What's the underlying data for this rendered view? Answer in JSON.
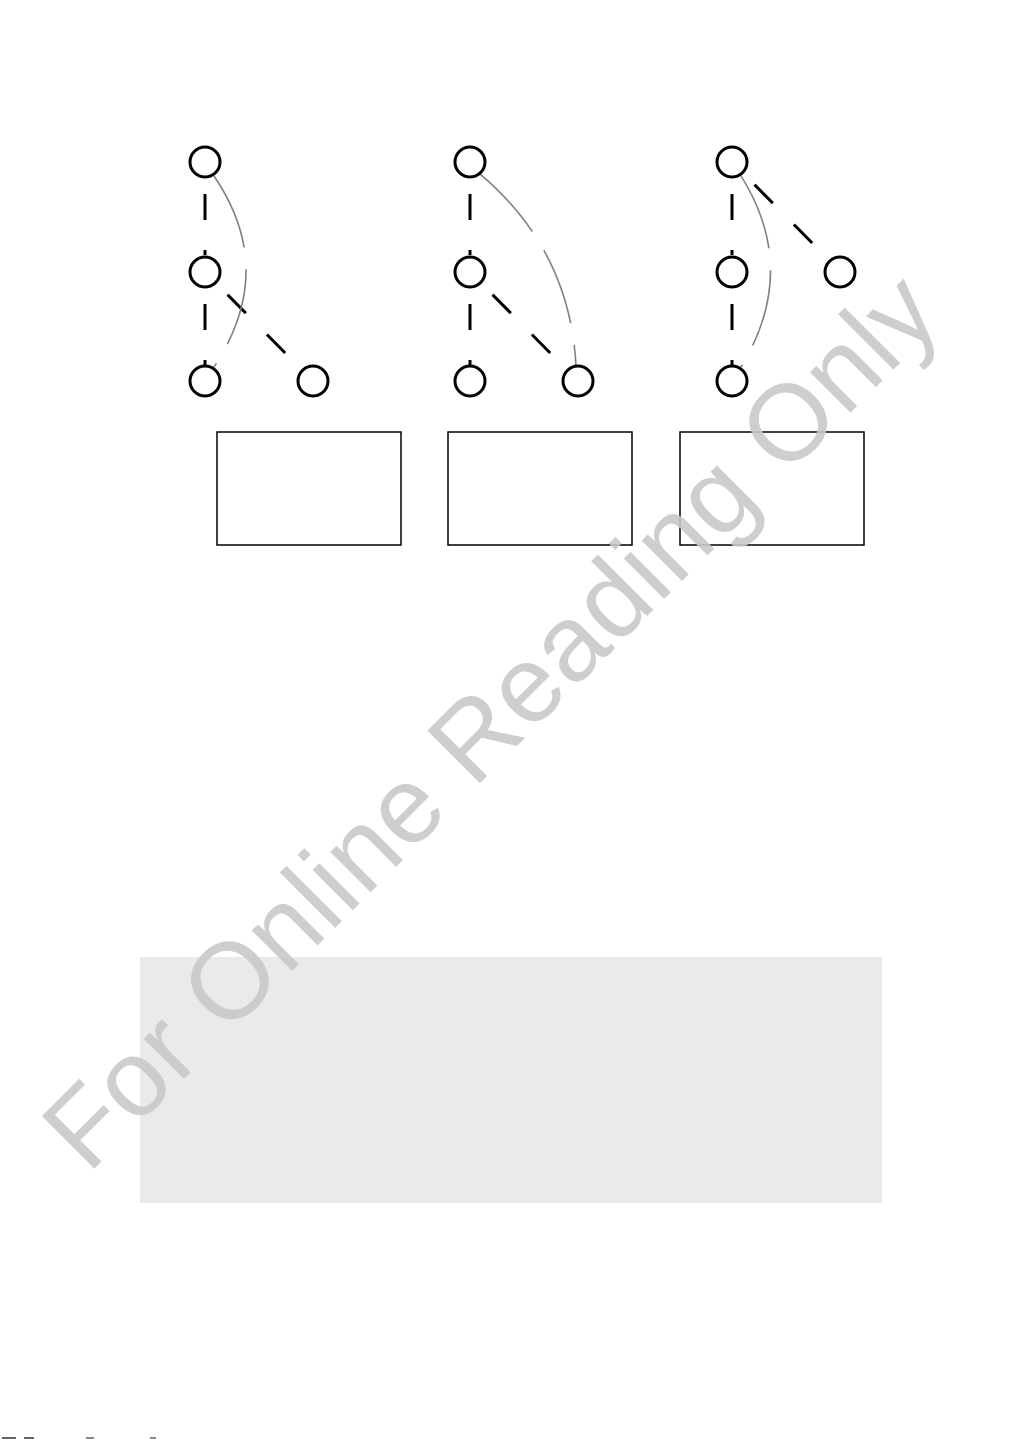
{
  "diagrams": [
    {
      "id": "tree-1",
      "nodes": [
        {
          "name": "node-root"
        },
        {
          "name": "node-middle"
        },
        {
          "name": "node-bottom-left"
        },
        {
          "name": "node-bottom-right"
        }
      ],
      "edges": [
        {
          "from": "node-root",
          "to": "node-middle"
        },
        {
          "from": "node-middle",
          "to": "node-bottom-left"
        },
        {
          "from": "node-middle",
          "to": "node-bottom-right"
        }
      ],
      "arc": {
        "from": "node-root",
        "to": "node-bottom-left"
      },
      "label_box_text": ""
    },
    {
      "id": "tree-2",
      "nodes": [
        {
          "name": "node-root"
        },
        {
          "name": "node-middle"
        },
        {
          "name": "node-bottom-left"
        },
        {
          "name": "node-bottom-right"
        }
      ],
      "edges": [
        {
          "from": "node-root",
          "to": "node-middle"
        },
        {
          "from": "node-middle",
          "to": "node-bottom-left"
        },
        {
          "from": "node-middle",
          "to": "node-bottom-right"
        }
      ],
      "arc": {
        "from": "node-root",
        "to": "node-bottom-right"
      },
      "label_box_text": ""
    },
    {
      "id": "tree-3",
      "nodes": [
        {
          "name": "node-root"
        },
        {
          "name": "node-middle"
        },
        {
          "name": "node-bottom-left"
        },
        {
          "name": "node-right"
        }
      ],
      "edges": [
        {
          "from": "node-root",
          "to": "node-middle"
        },
        {
          "from": "node-middle",
          "to": "node-bottom-left"
        },
        {
          "from": "node-root",
          "to": "node-right"
        }
      ],
      "arc": {
        "from": "node-root",
        "to": "node-bottom-left"
      },
      "label_box_text": ""
    }
  ],
  "colors": {
    "edge": "#000000",
    "arc": "#808080",
    "panel": "#eaeaea",
    "watermark": "#c9c9c9"
  },
  "watermark": {
    "text": "For Online Reading Only"
  }
}
